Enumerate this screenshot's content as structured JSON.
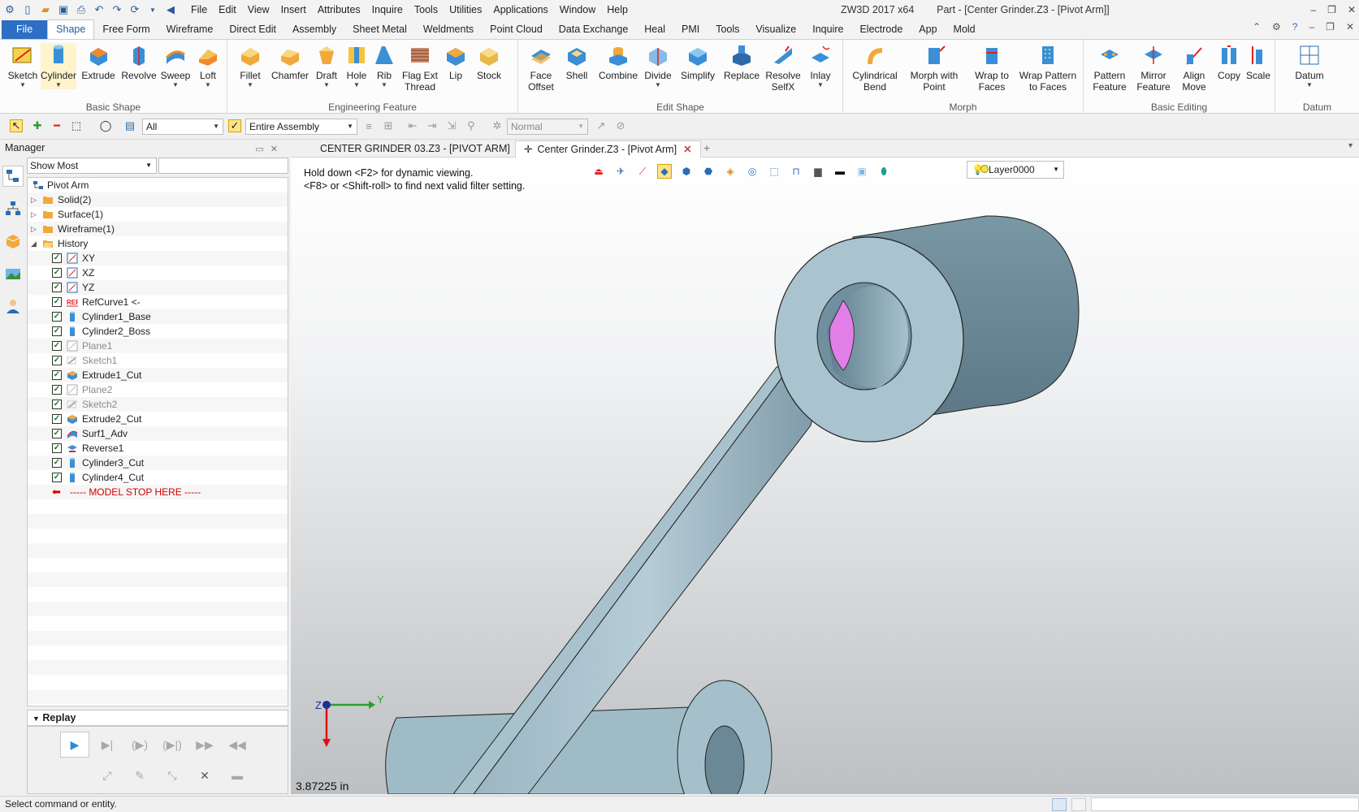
{
  "titlebar": {
    "app_title": "ZW3D 2017  x64",
    "doc_title": "Part - [Center Grinder.Z3 - [Pivot Arm]]",
    "menu": [
      "File",
      "Edit",
      "View",
      "Insert",
      "Attributes",
      "Inquire",
      "Tools",
      "Utilities",
      "Applications",
      "Window",
      "Help"
    ]
  },
  "ribbon_tabs": [
    "File",
    "Shape",
    "Free Form",
    "Wireframe",
    "Direct Edit",
    "Assembly",
    "Sheet Metal",
    "Weldments",
    "Point Cloud",
    "Data Exchange",
    "Heal",
    "PMI",
    "Tools",
    "Visualize",
    "Inquire",
    "Electrode",
    "App",
    "Mold"
  ],
  "active_tab": "Shape",
  "ribbon": {
    "basic_shape": {
      "label": "Basic Shape",
      "buttons": [
        "Sketch",
        "Cylinder",
        "Extrude",
        "Revolve",
        "Sweep",
        "Loft"
      ]
    },
    "engineering_feature": {
      "label": "Engineering Feature",
      "buttons": [
        "Fillet",
        "Chamfer",
        "Draft",
        "Hole",
        "Rib",
        "Flag Ext",
        "Thread",
        "Lip",
        "Stock"
      ]
    },
    "edit_shape": {
      "label": "Edit Shape",
      "buttons": [
        "Face",
        "Offset",
        "Shell",
        "Combine",
        "Divide",
        "Simplify",
        "Replace",
        "Resolve",
        "SelfX",
        "Inlay"
      ]
    },
    "morph": {
      "label": "Morph",
      "buttons": [
        "Cylindrical",
        "Bend",
        "Morph with",
        "Point",
        "Wrap to",
        "Faces",
        "Wrap Pattern",
        "to Faces"
      ]
    },
    "basic_editing": {
      "label": "Basic Editing",
      "buttons": [
        "Pattern",
        "Feature",
        "Mirror",
        "Feature",
        "Align",
        "Move",
        "Copy",
        "Scale"
      ]
    },
    "datum": {
      "label": "Datum",
      "buttons": [
        "Datum"
      ]
    }
  },
  "toolbar2": {
    "filter_value": "All",
    "scope_value": "Entire Assembly",
    "mode_value": "Normal"
  },
  "manager": {
    "title": "Manager",
    "filter_value": "Show Most",
    "tree": {
      "root": "Pivot Arm",
      "groups": [
        "Solid(2)",
        "Surface(1)",
        "Wireframe(1)",
        "History"
      ],
      "history": [
        "XY",
        "XZ",
        "YZ",
        "RefCurve1 <-",
        "Cylinder1_Base",
        "Cylinder2_Boss",
        "Plane1",
        "Sketch1",
        "Extrude1_Cut",
        "Plane2",
        "Sketch2",
        "Extrude2_Cut",
        "Surf1_Adv",
        "Reverse1",
        "Cylinder3_Cut",
        "Cylinder4_Cut"
      ],
      "stop_marker": "----- MODEL STOP HERE -----"
    },
    "replay_label": "Replay"
  },
  "doc_tabs": [
    {
      "label": "CENTER GRINDER 03.Z3 - [PIVOT ARM]",
      "active": false
    },
    {
      "label": "Center Grinder.Z3 - [Pivot Arm]",
      "active": true
    }
  ],
  "viewport": {
    "hint_line1": "Hold down <F2> for dynamic viewing.",
    "hint_line2": "<F8> or <Shift-roll> to find next valid filter setting.",
    "layer": "Layer0000",
    "distance": "3.87225 in",
    "axis_labels": [
      "Z",
      "Y"
    ]
  },
  "status": {
    "prompt": "Select command or entity."
  },
  "colors": {
    "accent": "#2c6fc4",
    "part": "#a9c4cf",
    "part_shadow": "#6d8a97",
    "bore_highlight": "#e27ee8"
  }
}
